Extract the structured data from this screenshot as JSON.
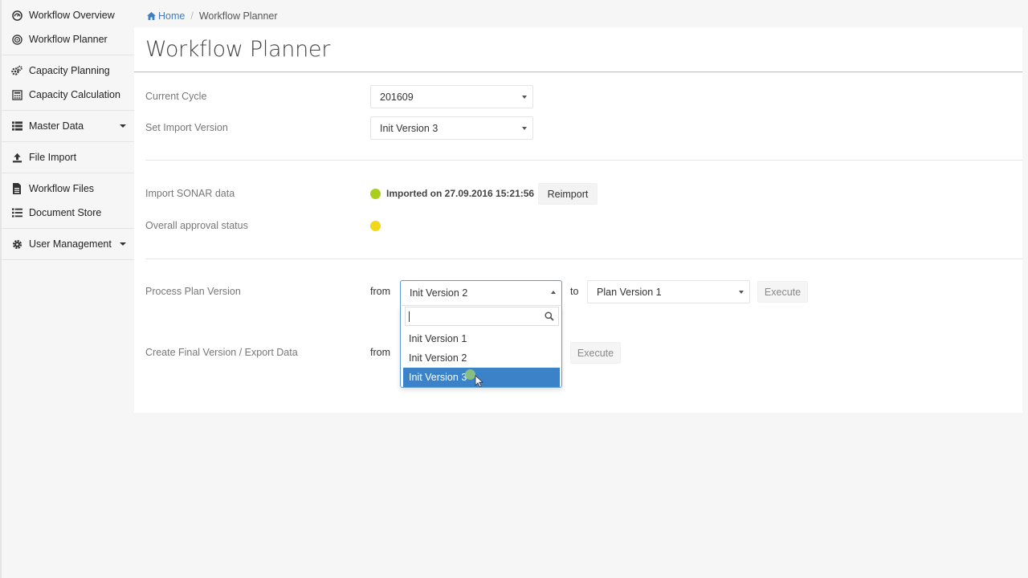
{
  "sidebar": {
    "groups": [
      [
        {
          "label": "Workflow Overview",
          "icon": "dashboard-icon"
        },
        {
          "label": "Workflow Planner",
          "icon": "target-icon"
        }
      ],
      [
        {
          "label": "Capacity Planning",
          "icon": "gears-icon"
        },
        {
          "label": "Capacity Calculation",
          "icon": "calculator-icon"
        }
      ],
      [
        {
          "label": "Master Data",
          "icon": "list-icon",
          "expandable": true
        }
      ],
      [
        {
          "label": "File Import",
          "icon": "upload-icon"
        }
      ],
      [
        {
          "label": "Workflow Files",
          "icon": "file-icon"
        },
        {
          "label": "Document Store",
          "icon": "list-icon"
        }
      ],
      [
        {
          "label": "User Management",
          "icon": "gear-icon",
          "expandable": true
        }
      ]
    ]
  },
  "breadcrumb": {
    "home": "Home",
    "separator": "/",
    "current": "Workflow Planner"
  },
  "page": {
    "title": "Workflow Planner"
  },
  "form": {
    "current_cycle": {
      "label": "Current Cycle",
      "value": "201609"
    },
    "import_version": {
      "label": "Set Import Version",
      "value": "Init Version 3"
    },
    "import_sonar": {
      "label": "Import SONAR data",
      "status_text": "Imported on 27.09.2016 15:21:56",
      "status_color": "#a8cf1c",
      "button": "Reimport"
    },
    "approval": {
      "label": "Overall approval status",
      "status_color": "#f1d81a"
    },
    "process_plan": {
      "label": "Process Plan Version",
      "from_label": "from",
      "from_value": "Init Version 2",
      "to_label": "to",
      "to_value": "Plan Version 1",
      "button": "Execute"
    },
    "final_version": {
      "label": "Create Final Version / Export Data",
      "from_label": "from",
      "button": "Execute"
    }
  },
  "dropdown": {
    "search_value": "",
    "options": [
      "Init Version 1",
      "Init Version 2",
      "Init Version 3"
    ],
    "highlighted": "Init Version 3",
    "highlight_color": "#3b82c8"
  }
}
